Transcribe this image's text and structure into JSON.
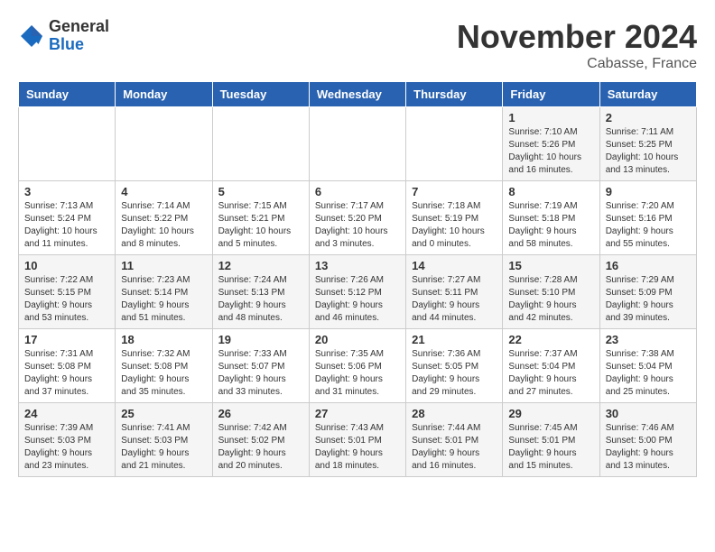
{
  "logo": {
    "general": "General",
    "blue": "Blue"
  },
  "title": "November 2024",
  "subtitle": "Cabasse, France",
  "days_of_week": [
    "Sunday",
    "Monday",
    "Tuesday",
    "Wednesday",
    "Thursday",
    "Friday",
    "Saturday"
  ],
  "weeks": [
    [
      {
        "day": "",
        "info": ""
      },
      {
        "day": "",
        "info": ""
      },
      {
        "day": "",
        "info": ""
      },
      {
        "day": "",
        "info": ""
      },
      {
        "day": "",
        "info": ""
      },
      {
        "day": "1",
        "info": "Sunrise: 7:10 AM\nSunset: 5:26 PM\nDaylight: 10 hours and 16 minutes."
      },
      {
        "day": "2",
        "info": "Sunrise: 7:11 AM\nSunset: 5:25 PM\nDaylight: 10 hours and 13 minutes."
      }
    ],
    [
      {
        "day": "3",
        "info": "Sunrise: 7:13 AM\nSunset: 5:24 PM\nDaylight: 10 hours and 11 minutes."
      },
      {
        "day": "4",
        "info": "Sunrise: 7:14 AM\nSunset: 5:22 PM\nDaylight: 10 hours and 8 minutes."
      },
      {
        "day": "5",
        "info": "Sunrise: 7:15 AM\nSunset: 5:21 PM\nDaylight: 10 hours and 5 minutes."
      },
      {
        "day": "6",
        "info": "Sunrise: 7:17 AM\nSunset: 5:20 PM\nDaylight: 10 hours and 3 minutes."
      },
      {
        "day": "7",
        "info": "Sunrise: 7:18 AM\nSunset: 5:19 PM\nDaylight: 10 hours and 0 minutes."
      },
      {
        "day": "8",
        "info": "Sunrise: 7:19 AM\nSunset: 5:18 PM\nDaylight: 9 hours and 58 minutes."
      },
      {
        "day": "9",
        "info": "Sunrise: 7:20 AM\nSunset: 5:16 PM\nDaylight: 9 hours and 55 minutes."
      }
    ],
    [
      {
        "day": "10",
        "info": "Sunrise: 7:22 AM\nSunset: 5:15 PM\nDaylight: 9 hours and 53 minutes."
      },
      {
        "day": "11",
        "info": "Sunrise: 7:23 AM\nSunset: 5:14 PM\nDaylight: 9 hours and 51 minutes."
      },
      {
        "day": "12",
        "info": "Sunrise: 7:24 AM\nSunset: 5:13 PM\nDaylight: 9 hours and 48 minutes."
      },
      {
        "day": "13",
        "info": "Sunrise: 7:26 AM\nSunset: 5:12 PM\nDaylight: 9 hours and 46 minutes."
      },
      {
        "day": "14",
        "info": "Sunrise: 7:27 AM\nSunset: 5:11 PM\nDaylight: 9 hours and 44 minutes."
      },
      {
        "day": "15",
        "info": "Sunrise: 7:28 AM\nSunset: 5:10 PM\nDaylight: 9 hours and 42 minutes."
      },
      {
        "day": "16",
        "info": "Sunrise: 7:29 AM\nSunset: 5:09 PM\nDaylight: 9 hours and 39 minutes."
      }
    ],
    [
      {
        "day": "17",
        "info": "Sunrise: 7:31 AM\nSunset: 5:08 PM\nDaylight: 9 hours and 37 minutes."
      },
      {
        "day": "18",
        "info": "Sunrise: 7:32 AM\nSunset: 5:08 PM\nDaylight: 9 hours and 35 minutes."
      },
      {
        "day": "19",
        "info": "Sunrise: 7:33 AM\nSunset: 5:07 PM\nDaylight: 9 hours and 33 minutes."
      },
      {
        "day": "20",
        "info": "Sunrise: 7:35 AM\nSunset: 5:06 PM\nDaylight: 9 hours and 31 minutes."
      },
      {
        "day": "21",
        "info": "Sunrise: 7:36 AM\nSunset: 5:05 PM\nDaylight: 9 hours and 29 minutes."
      },
      {
        "day": "22",
        "info": "Sunrise: 7:37 AM\nSunset: 5:04 PM\nDaylight: 9 hours and 27 minutes."
      },
      {
        "day": "23",
        "info": "Sunrise: 7:38 AM\nSunset: 5:04 PM\nDaylight: 9 hours and 25 minutes."
      }
    ],
    [
      {
        "day": "24",
        "info": "Sunrise: 7:39 AM\nSunset: 5:03 PM\nDaylight: 9 hours and 23 minutes."
      },
      {
        "day": "25",
        "info": "Sunrise: 7:41 AM\nSunset: 5:03 PM\nDaylight: 9 hours and 21 minutes."
      },
      {
        "day": "26",
        "info": "Sunrise: 7:42 AM\nSunset: 5:02 PM\nDaylight: 9 hours and 20 minutes."
      },
      {
        "day": "27",
        "info": "Sunrise: 7:43 AM\nSunset: 5:01 PM\nDaylight: 9 hours and 18 minutes."
      },
      {
        "day": "28",
        "info": "Sunrise: 7:44 AM\nSunset: 5:01 PM\nDaylight: 9 hours and 16 minutes."
      },
      {
        "day": "29",
        "info": "Sunrise: 7:45 AM\nSunset: 5:01 PM\nDaylight: 9 hours and 15 minutes."
      },
      {
        "day": "30",
        "info": "Sunrise: 7:46 AM\nSunset: 5:00 PM\nDaylight: 9 hours and 13 minutes."
      }
    ]
  ]
}
